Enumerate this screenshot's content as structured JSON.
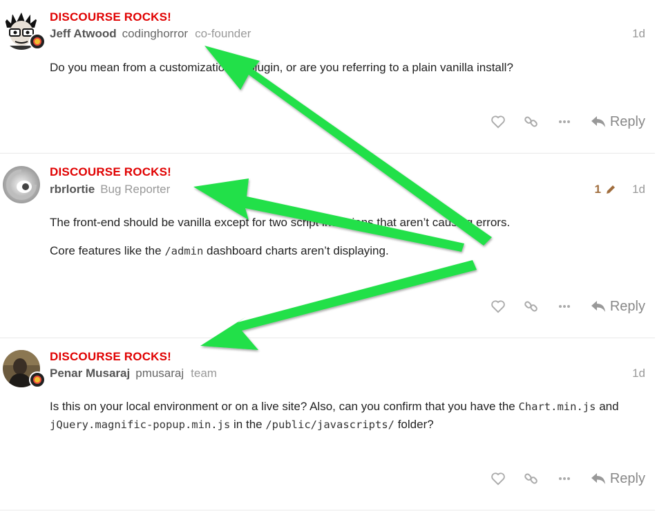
{
  "posts": [
    {
      "flair": "DISCOURSE ROCKS!",
      "full_name": "Jeff Atwood",
      "username": "codinghorror",
      "user_title": "co-founder",
      "age": "1d",
      "paragraphs": [
        [
          {
            "t": "Do you mean from a customization or plugin, or are you referring to a plain vanilla install?"
          }
        ]
      ],
      "reply_label": "Reply",
      "avatar_icon": "cartoon-avatar-icon",
      "has_flair_badge": true
    },
    {
      "flair": "DISCOURSE ROCKS!",
      "full_name": "rbrlortie",
      "username": "",
      "user_title": "Bug Reporter",
      "age": "1d",
      "edit_count": "1",
      "paragraphs": [
        [
          {
            "t": "The front-end should be vanilla except for two script inclusions that aren’t causing errors."
          }
        ],
        [
          {
            "t": "Core features like the "
          },
          {
            "c": "/admin"
          },
          {
            "t": " dashboard charts aren’t displaying."
          }
        ]
      ],
      "reply_label": "Reply",
      "avatar_icon": "swirl-avatar-icon",
      "has_flair_badge": false
    },
    {
      "flair": "DISCOURSE ROCKS!",
      "full_name": "Penar Musaraj",
      "username": "pmusaraj",
      "user_title": "team",
      "age": "1d",
      "paragraphs": [
        [
          {
            "t": "Is this on your local environment or on a live site? Also, can you confirm that you have the "
          },
          {
            "c": "Chart.min.js"
          },
          {
            "t": " and "
          },
          {
            "br": true
          },
          {
            "c": "jQuery.magnific-popup.min.js"
          },
          {
            "t": " in the "
          },
          {
            "c": "/public/javascripts/"
          },
          {
            "t": " folder?"
          }
        ]
      ],
      "reply_label": "Reply",
      "avatar_icon": "photo-avatar-icon",
      "has_flair_badge": true
    }
  ],
  "colors": {
    "flair_red": "#e00000",
    "annotation_green": "#22e04a",
    "edit_brown": "#a06d3d"
  }
}
